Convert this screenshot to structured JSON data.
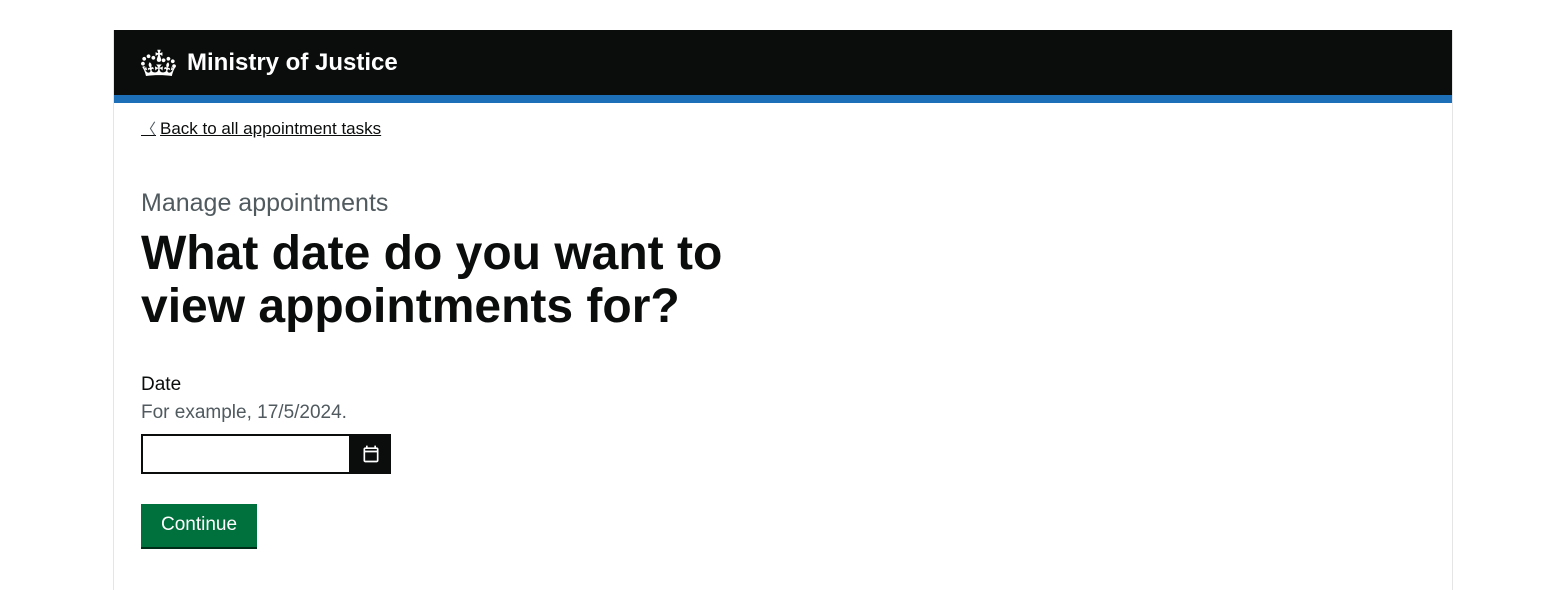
{
  "header": {
    "org_name": "Ministry of Justice"
  },
  "back_link": {
    "label": "Back to all appointment tasks"
  },
  "main": {
    "caption": "Manage appointments",
    "heading": "What date do you want to view appointments for?",
    "date_field": {
      "label": "Date",
      "hint": "For example, 17/5/2024.",
      "value": ""
    },
    "continue_label": "Continue"
  }
}
